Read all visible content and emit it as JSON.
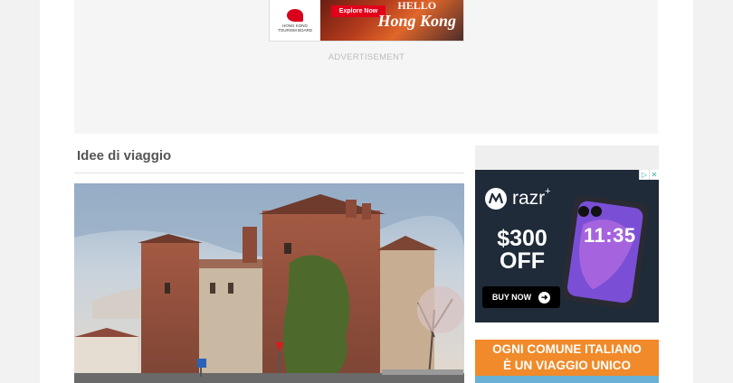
{
  "top_ad": {
    "brand_lines": [
      "HONG KONG",
      "TOURISM BOARD"
    ],
    "button_label": "Explore Now",
    "headline_line1": "HELLO",
    "headline_line2": "Hong Kong",
    "label": "ADVERTISEMENT"
  },
  "section": {
    "title": "Idee di viaggio"
  },
  "side_ad_1": {
    "brand": "razr",
    "brand_sup": "+",
    "price_line1": "$300",
    "price_line2": "OFF",
    "button_label": "BUY NOW",
    "phone_time": "11:35",
    "adchoices_icon": "adchoices-icon",
    "close_icon": "close-icon",
    "colors": {
      "bg": "#1f2b39",
      "screen": "#7a4fd6"
    }
  },
  "side_ad_2": {
    "line1": "OGNI COMUNE ITALIANO",
    "line2": "È UN VIAGGIO UNICO",
    "colors": {
      "bg": "#f08a2a"
    }
  }
}
